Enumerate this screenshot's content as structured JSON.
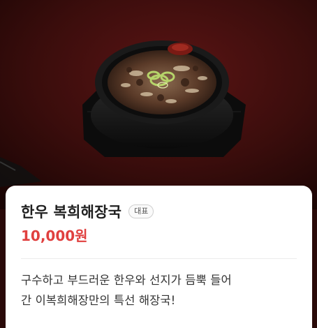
{
  "menu_item": {
    "name": "한우 복희해장국",
    "badge": "대표",
    "price": "10,000원",
    "description": "구수하고 부드러운 한우와 선지가 듬뿍 들어\n간 이복희해장만의 특선 해장국!"
  },
  "colors": {
    "price": "#e0403f",
    "title": "#1f1f1f",
    "background": "#2a0a09"
  }
}
